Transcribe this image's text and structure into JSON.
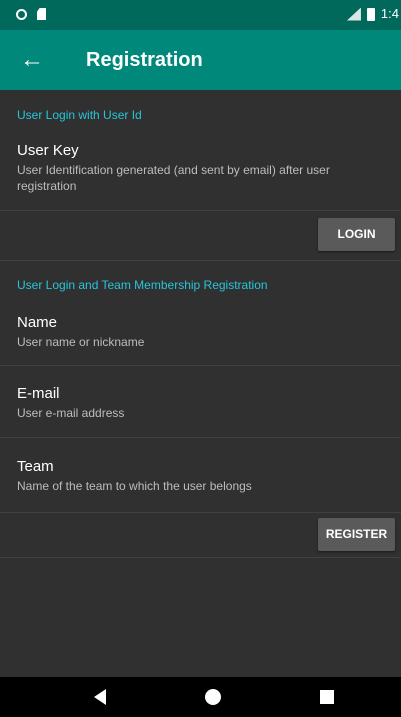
{
  "status_bar": {
    "time": "1:4",
    "icons": [
      "circle-icon",
      "sd-card-icon",
      "signal-icon",
      "battery-icon"
    ]
  },
  "app_bar": {
    "title": "Registration",
    "back_icon": "←"
  },
  "login_section": {
    "header": "User Login with User Id",
    "user_key": {
      "title": "User Key",
      "summary": "User Identification generated (and sent by email) after user registration"
    },
    "login_button": "LOGIN"
  },
  "registration_section": {
    "header": "User Login and Team Membership Registration",
    "name": {
      "title": "Name",
      "summary": "User name or nickname"
    },
    "email": {
      "title": "E-mail",
      "summary": "User e-mail address"
    },
    "team": {
      "title": "Team",
      "summary": "Name of the team to which the user belongs"
    },
    "register_button": "REGISTER"
  },
  "colors": {
    "status_bar": "#00695c",
    "app_bar": "#00897b",
    "background": "#303030",
    "category_text": "#26c6da",
    "button": "#5a5a5a"
  }
}
